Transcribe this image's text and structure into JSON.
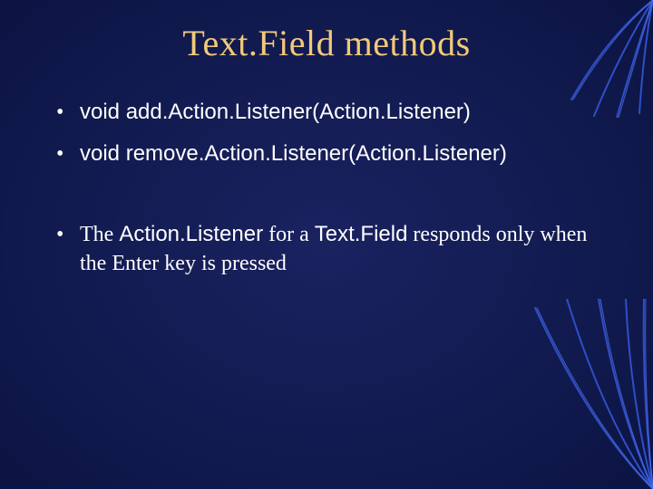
{
  "title": "Text.Field methods",
  "bullets": {
    "b1": "void add.Action.Listener(Action.Listener)",
    "b2": "void remove.Action.Listener(Action.Listener)",
    "b3_parts": {
      "p1": "The ",
      "p2": "Action.Listener",
      "p3": " for a ",
      "p4": "Text.Field",
      "p5": " responds only when the Enter key is pressed"
    }
  },
  "decor": {
    "stroke": "#3a5bd8",
    "stroke_highlight": "#6a8bff"
  }
}
